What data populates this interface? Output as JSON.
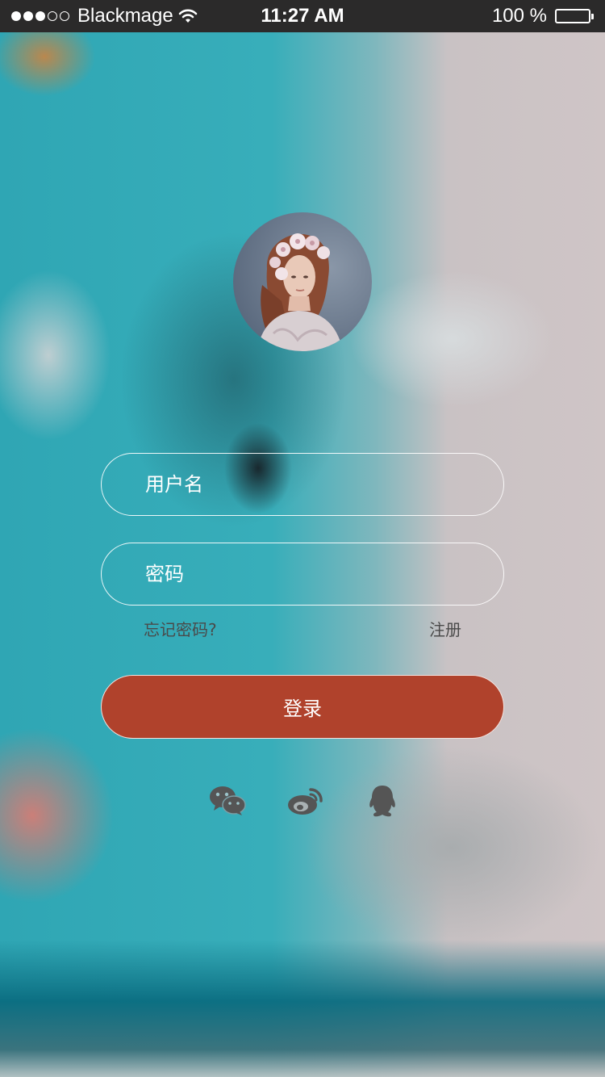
{
  "status_bar": {
    "carrier": "Blackmage",
    "time": "11:27 AM",
    "battery": "100 %",
    "signal_strength": 3,
    "signal_total": 5
  },
  "avatar": {
    "icon": "user-photo-avatar"
  },
  "form": {
    "username_placeholder": "用户名",
    "password_placeholder": "密码",
    "forgot_password": "忘记密码?",
    "register": "注册",
    "login_button": "登录"
  },
  "social_login": [
    {
      "icon": "wechat-icon"
    },
    {
      "icon": "weibo-icon"
    },
    {
      "icon": "qq-icon"
    }
  ],
  "colors": {
    "login_button": "#b0422c",
    "status_bar": "#2b2a2a",
    "icon_gray": "#555555"
  }
}
